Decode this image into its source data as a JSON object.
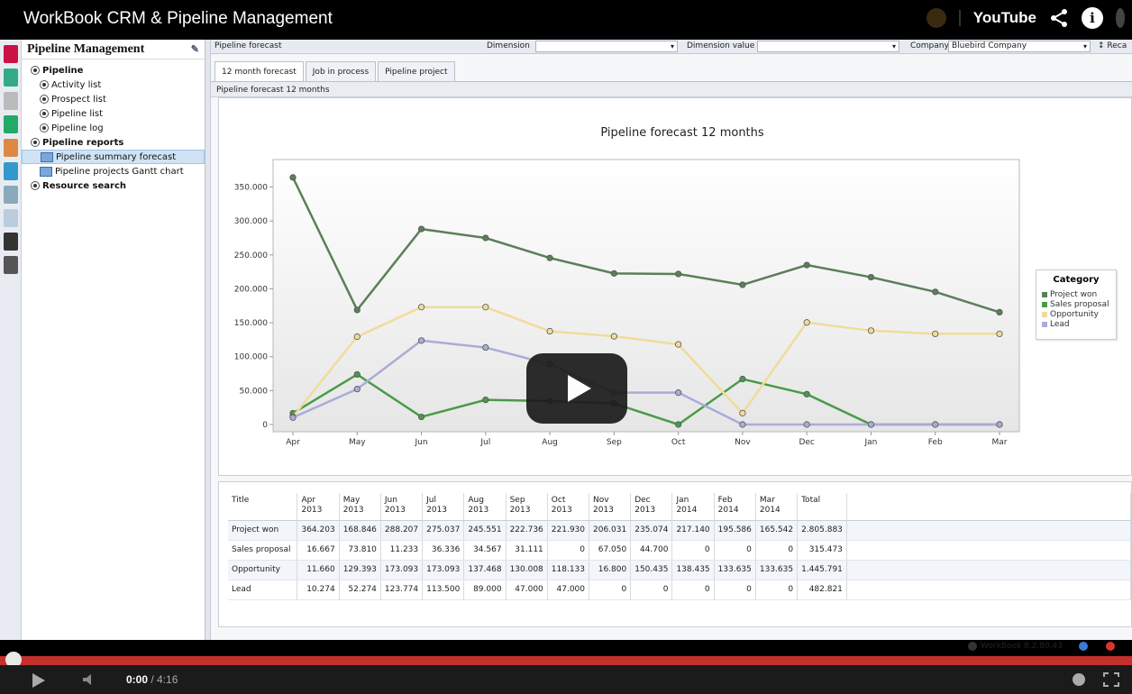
{
  "video": {
    "title": "WorkBook CRM & Pipeline Management",
    "brand": "YouTube",
    "current_time": "0:00",
    "duration": "/ 4:16"
  },
  "nav": {
    "header": "Pipeline Management",
    "items": [
      {
        "label": "Pipeline",
        "level": 0
      },
      {
        "label": "Activity list",
        "level": 1
      },
      {
        "label": "Prospect list",
        "level": 1
      },
      {
        "label": "Pipeline list",
        "level": 1
      },
      {
        "label": "Pipeline log",
        "level": 1
      },
      {
        "label": "Pipeline reports",
        "level": 0
      },
      {
        "label": "Pipeline summary forecast",
        "level": 1,
        "selected": true
      },
      {
        "label": "Pipeline projects Gantt chart",
        "level": 1
      },
      {
        "label": "Resource search",
        "level": 0
      }
    ]
  },
  "filters": {
    "view": "Pipeline forecast",
    "dimension_label": "Dimension",
    "dimension_value_label": "Dimension value",
    "company_label": "Company",
    "company_value": "Bluebird Company",
    "recalc_label": "Reca"
  },
  "tabs": [
    "12 month forecast",
    "Job in process",
    "Pipeline project"
  ],
  "panel_title": "Pipeline forecast 12 months",
  "table": {
    "title_header": "Title",
    "headers": [
      [
        "Apr",
        "2013"
      ],
      [
        "May",
        "2013"
      ],
      [
        "Jun",
        "2013"
      ],
      [
        "Jul",
        "2013"
      ],
      [
        "Aug",
        "2013"
      ],
      [
        "Sep",
        "2013"
      ],
      [
        "Oct",
        "2013"
      ],
      [
        "Nov",
        "2013"
      ],
      [
        "Dec",
        "2013"
      ],
      [
        "Jan",
        "2014"
      ],
      [
        "Feb",
        "2014"
      ],
      [
        "Mar",
        "2014"
      ]
    ],
    "total_header": "Total",
    "rows": [
      {
        "label": "Project won",
        "values": [
          "364.203",
          "168.846",
          "288.207",
          "275.037",
          "245.551",
          "222.736",
          "221.930",
          "206.031",
          "235.074",
          "217.140",
          "195.586",
          "165.542"
        ],
        "total": "2.805.883"
      },
      {
        "label": "Sales proposal",
        "values": [
          "16.667",
          "73.810",
          "11.233",
          "36.336",
          "34.567",
          "31.111",
          "0",
          "67.050",
          "44.700",
          "0",
          "0",
          "0"
        ],
        "total": "315.473"
      },
      {
        "label": "Opportunity",
        "values": [
          "11.660",
          "129.393",
          "173.093",
          "173.093",
          "137.468",
          "130.008",
          "118.133",
          "16.800",
          "150.435",
          "138.435",
          "133.635",
          "133.635"
        ],
        "total": "1.445.791"
      },
      {
        "label": "Lead",
        "values": [
          "10.274",
          "52.274",
          "123.774",
          "113.500",
          "89.000",
          "47.000",
          "47.000",
          "0",
          "0",
          "0",
          "0",
          "0"
        ],
        "total": "482.821"
      }
    ]
  },
  "status": {
    "version": "WorkBook 8.2.80.43"
  },
  "chart_data": {
    "type": "line",
    "title": "Pipeline forecast 12 months",
    "categories": [
      "Apr",
      "May",
      "Jun",
      "Jul",
      "Aug",
      "Sep",
      "Oct",
      "Nov",
      "Dec",
      "Jan",
      "Feb",
      "Mar"
    ],
    "y_ticks": [
      "350.000",
      "300.000",
      "250.000",
      "200.000",
      "150.000",
      "100.000",
      "50.000",
      "0"
    ],
    "ylim": [
      0,
      380000
    ],
    "legend_title": "Category",
    "legend_position": "right",
    "series": [
      {
        "name": "Project won",
        "color": "#5b7f58",
        "values": [
          364203,
          168846,
          288207,
          275037,
          245551,
          222736,
          221930,
          206031,
          235074,
          217140,
          195586,
          165542
        ]
      },
      {
        "name": "Sales proposal",
        "color": "#4a9a48",
        "values": [
          16667,
          73810,
          11233,
          36336,
          34567,
          31111,
          0,
          67050,
          44700,
          0,
          0,
          0
        ]
      },
      {
        "name": "Opportunity",
        "color": "#f0dc9a",
        "values": [
          11660,
          129393,
          173093,
          173093,
          137468,
          130008,
          118133,
          16800,
          150435,
          138435,
          133635,
          133635
        ]
      },
      {
        "name": "Lead",
        "color": "#a9acd8",
        "values": [
          10274,
          52274,
          123774,
          113500,
          89000,
          47000,
          47000,
          0,
          0,
          0,
          0,
          0
        ]
      }
    ]
  }
}
